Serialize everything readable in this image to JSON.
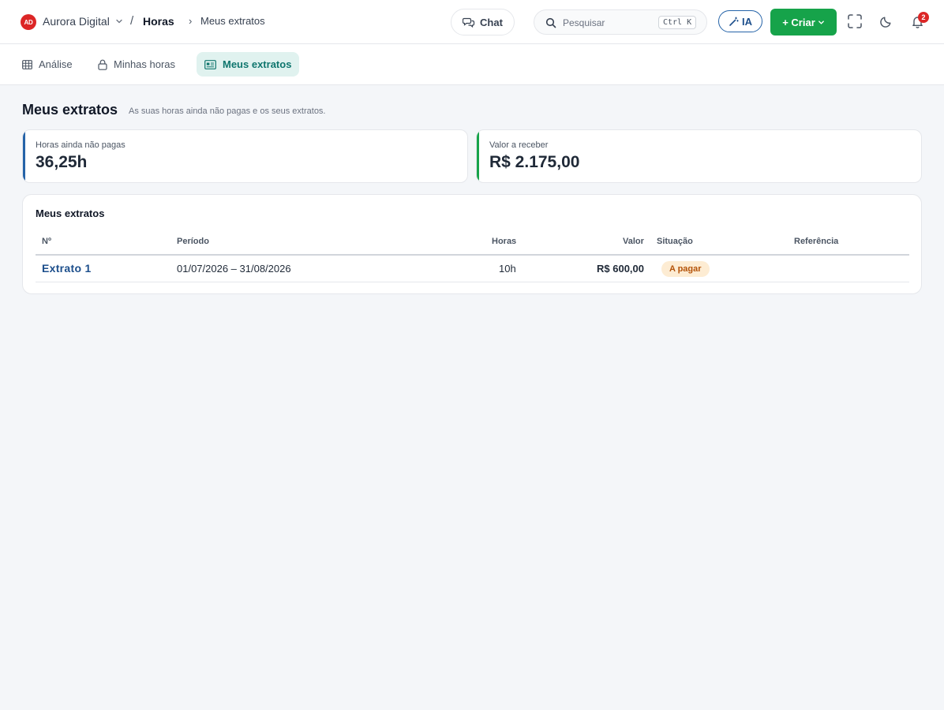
{
  "header": {
    "org_initials": "AD",
    "org_name": "Aurora Digital",
    "breadcrumb_separator": "/",
    "section": "Horas",
    "breadcrumb_arrow": "›",
    "current_page": "Meus extratos",
    "chat_label": "Chat",
    "search_placeholder": "Pesquisar",
    "search_shortcut": "Ctrl K",
    "ia_label": "IA",
    "create_label": "+ Criar",
    "notification_count": "2"
  },
  "tabs": [
    {
      "label": "Análise",
      "icon": "table-icon",
      "active": false
    },
    {
      "label": "Minhas horas",
      "icon": "lock-icon",
      "active": false
    },
    {
      "label": "Meus extratos",
      "icon": "id-card-icon",
      "active": true
    }
  ],
  "page": {
    "title": "Meus extratos",
    "subtitle": "As suas horas ainda não pagas e os seus extratos."
  },
  "stats": [
    {
      "label": "Horas ainda não pagas",
      "value": "36,25h",
      "accent": "#2563a8"
    },
    {
      "label": "Valor a receber",
      "value": "R$ 2.175,00",
      "accent": "#16a34a"
    }
  ],
  "statements": {
    "title": "Meus extratos",
    "columns": [
      "Nº",
      "Período",
      "Horas",
      "Valor",
      "Situação",
      "Referência"
    ],
    "rows": [
      {
        "number": "Extrato 1",
        "period": "01/07/2026 – 31/08/2026",
        "hours": "10h",
        "value": "R$ 600,00",
        "status": "A pagar",
        "reference": ""
      }
    ]
  },
  "colors": {
    "primary": "#1d4f8c",
    "success": "#16a34a",
    "danger": "#dc2626",
    "active_tab_bg": "#e0f2ef",
    "active_tab_text": "#0f766e",
    "status_pending_bg": "#fdecd3",
    "status_pending_text": "#b45309"
  }
}
